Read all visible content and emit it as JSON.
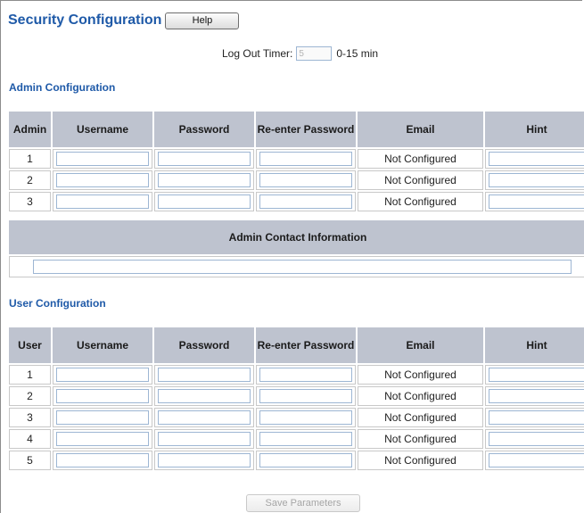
{
  "page": {
    "title": "Security Configuration",
    "help_label": "Help"
  },
  "logout": {
    "label": "Log Out Timer:",
    "value": "5",
    "range": "0-15 min"
  },
  "admin": {
    "section_title": "Admin Configuration",
    "headers": [
      "Admin",
      "Username",
      "Password",
      "Re-enter Password",
      "Email",
      "Hint"
    ],
    "rows": [
      {
        "id": "1",
        "email": "Not Configured"
      },
      {
        "id": "2",
        "email": "Not Configured"
      },
      {
        "id": "3",
        "email": "Not Configured"
      }
    ],
    "contact_header": "Admin Contact Information"
  },
  "user": {
    "section_title": "User Configuration",
    "headers": [
      "User",
      "Username",
      "Password",
      "Re-enter Password",
      "Email",
      "Hint"
    ],
    "rows": [
      {
        "id": "1",
        "email": "Not Configured"
      },
      {
        "id": "2",
        "email": "Not Configured"
      },
      {
        "id": "3",
        "email": "Not Configured"
      },
      {
        "id": "4",
        "email": "Not Configured"
      },
      {
        "id": "5",
        "email": "Not Configured"
      }
    ]
  },
  "save_label": "Save Parameters"
}
